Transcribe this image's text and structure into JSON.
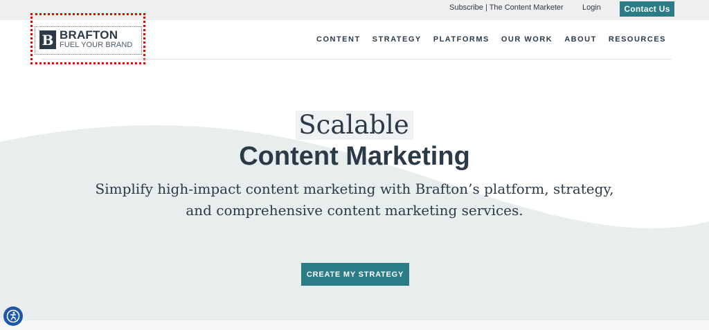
{
  "topbar": {
    "subscribe": "Subscribe | The Content Marketer",
    "login": "Login",
    "contact": "Contact Us"
  },
  "logo": {
    "mark": "B",
    "name": "BRAFTON",
    "tagline": "FUEL YOUR BRAND"
  },
  "nav": {
    "items": [
      "CONTENT",
      "STRATEGY",
      "PLATFORMS",
      "OUR WORK",
      "ABOUT",
      "RESOURCES"
    ]
  },
  "hero": {
    "pre": "Scalable",
    "title": "Content Marketing",
    "sub_line1": "Simplify high-impact content marketing with Brafton’s platform, strategy,",
    "sub_line2": "and comprehensive content marketing services.",
    "cta": "CREATE MY STRATEGY"
  },
  "icons": {
    "accessibility": "accessibility-icon"
  },
  "colors": {
    "accent": "#2a7c87",
    "text": "#2b3a46",
    "wave": "#e8edee",
    "a11y": "#1d57a8"
  }
}
